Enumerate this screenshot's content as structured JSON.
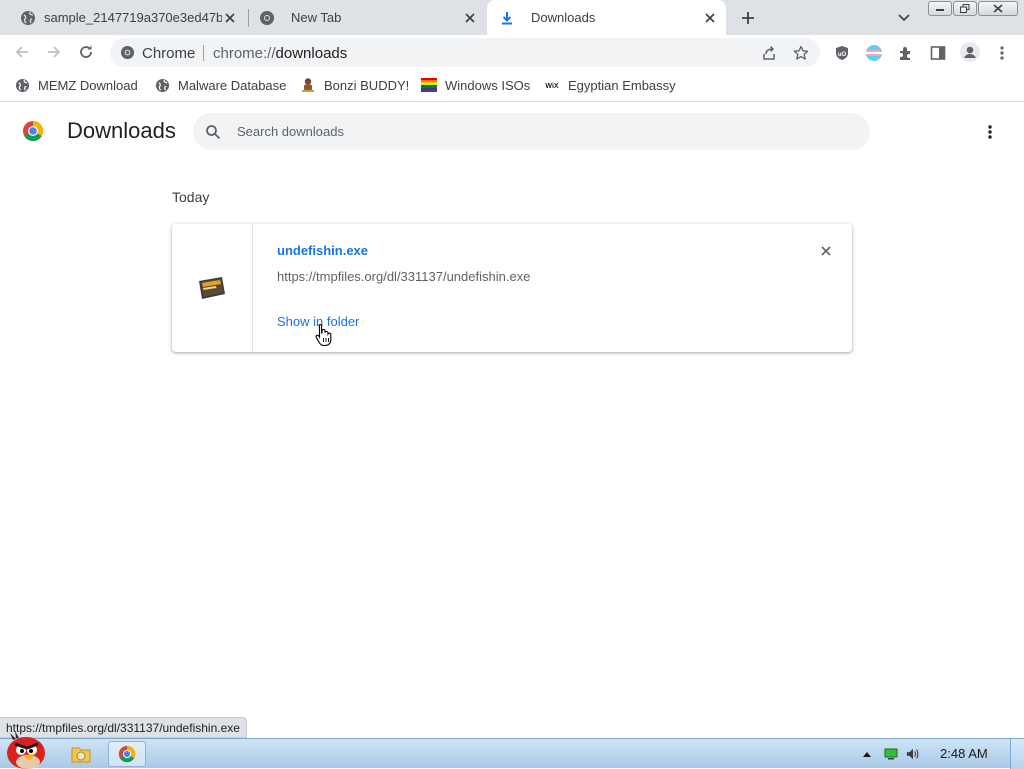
{
  "tabs": [
    {
      "title": "sample_2147719a370e3ed47b",
      "icon": "globe-icon"
    },
    {
      "title": "New Tab",
      "icon": "chrome-icon"
    },
    {
      "title": "Downloads",
      "icon": "download-icon"
    }
  ],
  "omnibox": {
    "origin": "Chrome",
    "scheme": "chrome://",
    "path": "downloads"
  },
  "bookmarks": [
    {
      "label": "MEMZ Download",
      "icon": "globe-icon"
    },
    {
      "label": "Malware Database",
      "icon": "globe-icon"
    },
    {
      "label": "Bonzi BUDDY!",
      "icon": "bonzi-icon"
    },
    {
      "label": "Windows ISOs",
      "icon": "rainbow-flag-icon"
    },
    {
      "label": "Egyptian Embassy",
      "icon": "wix-icon"
    }
  ],
  "downloads_page": {
    "title": "Downloads",
    "search_placeholder": "Search downloads",
    "date_header": "Today",
    "item": {
      "file_name": "undefishin.exe",
      "url": "https://tmpfiles.org/dl/331137/undefishin.exe",
      "action": "Show in folder"
    }
  },
  "status_url": "https://tmpfiles.org/dl/331137/undefishin.exe",
  "taskbar": {
    "clock": "2:48 AM"
  },
  "colors": {
    "accent": "#1a73e8",
    "tabstrip": "#dee1e6",
    "taskbar": "#b9d4ef"
  }
}
